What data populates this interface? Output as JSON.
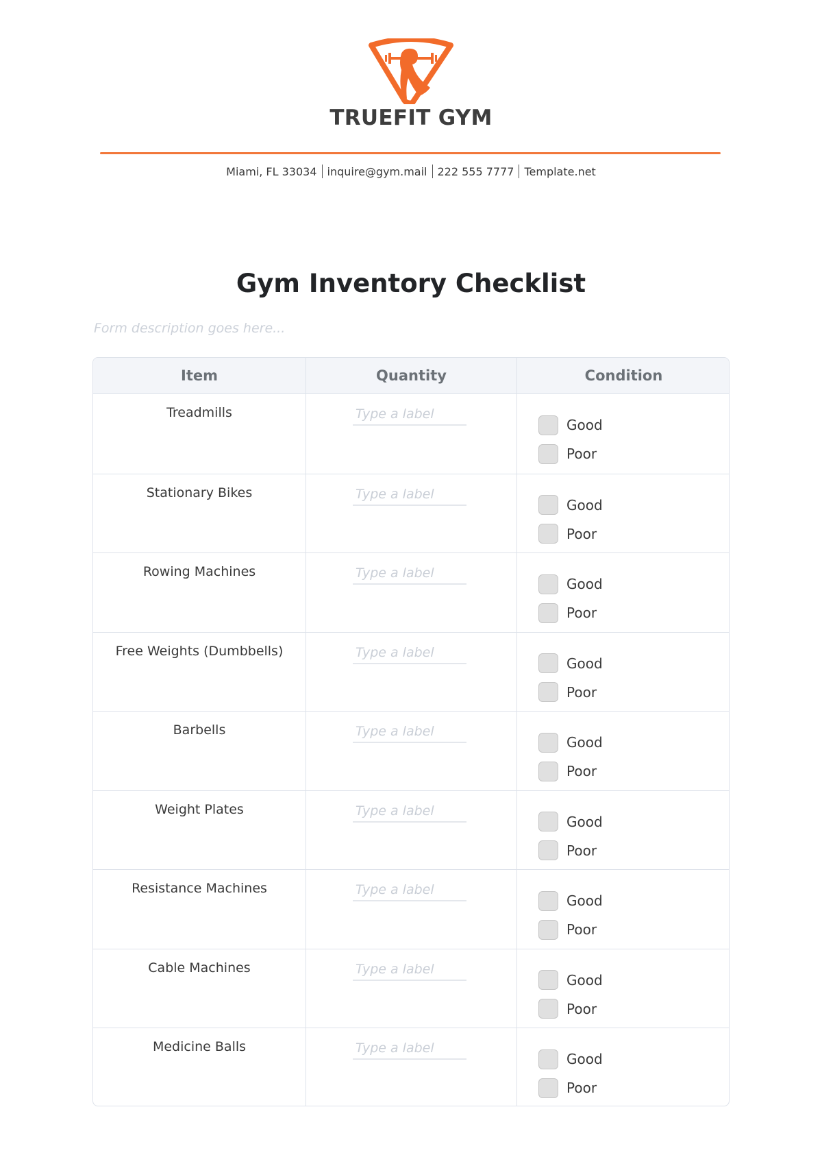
{
  "header": {
    "brand": "TRUEFIT GYM",
    "logo_icon": "shield-weightlifter-icon",
    "accent_color": "#f26b2a",
    "contact": [
      "Miami, FL 33034",
      "inquire@gym.mail",
      "222 555 7777",
      "Template.net"
    ]
  },
  "form": {
    "title": "Gym Inventory Checklist",
    "description_placeholder": "Form description goes here..."
  },
  "table": {
    "columns": [
      "Item",
      "Quantity",
      "Condition"
    ],
    "quantity_placeholder": "Type a label",
    "condition_options": [
      "Good",
      "Poor"
    ],
    "rows": [
      {
        "item": "Treadmills",
        "quantity": "",
        "good": false,
        "poor": false
      },
      {
        "item": "Stationary Bikes",
        "quantity": "",
        "good": false,
        "poor": false
      },
      {
        "item": "Rowing Machines",
        "quantity": "",
        "good": false,
        "poor": false
      },
      {
        "item": "Free Weights (Dumbbells)",
        "quantity": "",
        "good": false,
        "poor": false
      },
      {
        "item": "Barbells",
        "quantity": "",
        "good": false,
        "poor": false
      },
      {
        "item": "Weight Plates",
        "quantity": "",
        "good": false,
        "poor": false
      },
      {
        "item": "Resistance Machines",
        "quantity": "",
        "good": false,
        "poor": false
      },
      {
        "item": "Cable Machines",
        "quantity": "",
        "good": false,
        "poor": false
      },
      {
        "item": "Medicine Balls",
        "quantity": "",
        "good": false,
        "poor": false
      }
    ]
  }
}
